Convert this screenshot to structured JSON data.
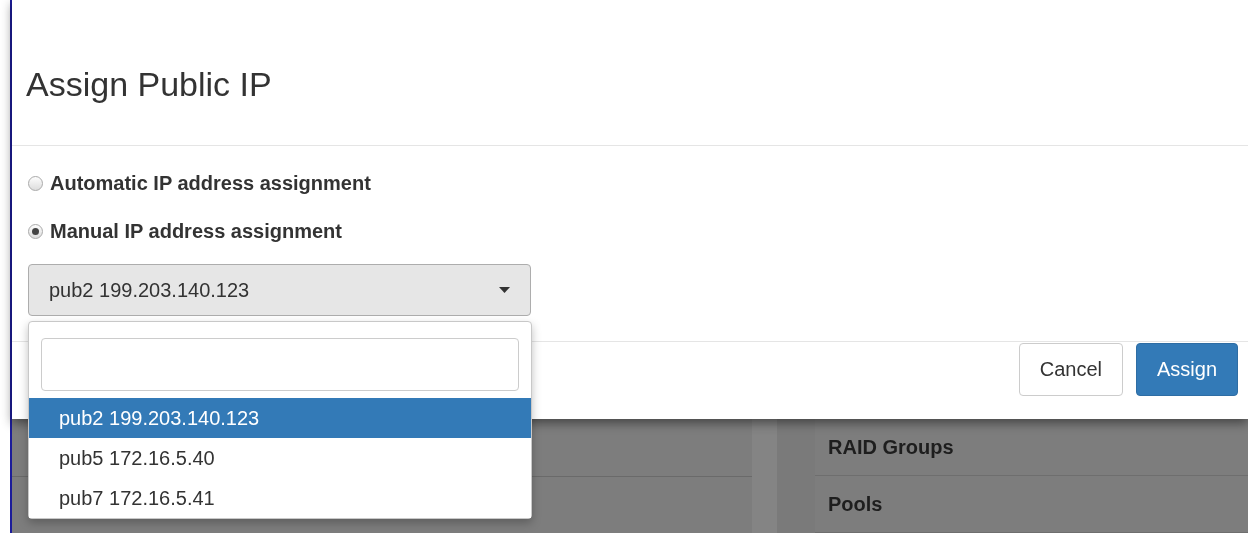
{
  "modal": {
    "title": "Assign Public IP",
    "options": [
      {
        "label": "Automatic IP address assignment",
        "selected": false
      },
      {
        "label": "Manual IP address assignment",
        "selected": true
      }
    ],
    "select": {
      "value": "pub2 199.203.140.123",
      "expanded": true,
      "items": [
        {
          "label": "pub2 199.203.140.123",
          "selected": true
        },
        {
          "label": "pub5 172.16.5.40",
          "selected": false
        },
        {
          "label": "pub7 172.16.5.41",
          "selected": false
        }
      ]
    },
    "buttons": [
      {
        "label": "Cancel",
        "kind": "default"
      },
      {
        "label": "Assign",
        "kind": "primary"
      }
    ]
  },
  "background": {
    "items": [
      "RAID Groups",
      "Pools"
    ]
  }
}
